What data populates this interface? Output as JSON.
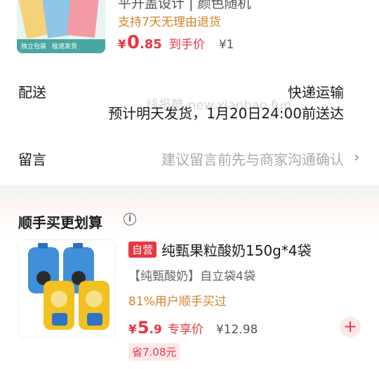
{
  "top_product": {
    "name_cut": "平开盖设计 | 颜色随机",
    "refund_policy": "支持7天无理由退货",
    "price_currency": "¥",
    "price_int": "0",
    "price_dec": ".85",
    "price_tag": "到手价",
    "original_price": "¥1",
    "thumb_badges": [
      "独立包装",
      "极速发货"
    ]
  },
  "delivery": {
    "label": "配送",
    "method": "快递运输",
    "estimate": "预计明天发货，1月20日24:00前送达"
  },
  "watermark": "线报酷 new.xianbao.fun",
  "message": {
    "label": "留言",
    "placeholder": "建议留言前先与商家沟通确认",
    "chevron": "›"
  },
  "bundle": {
    "title": "顺手买更划算",
    "info_glyph": "i",
    "item": {
      "badge": "自营",
      "name": "纯甄果粒酸奶150g*4袋",
      "subtitle": "【纯甄酸奶】自立袋4袋",
      "bought_pct": "81%用户顺手买过",
      "price_currency": "¥",
      "price_int": "5",
      "price_dec": ".9",
      "price_tag": "专享价",
      "original_price": "¥12.98",
      "save_label": "省7.08元",
      "add_glyph": "+"
    }
  },
  "colors": {
    "accent_red": "#e8373f",
    "accent_orange": "#d4822c",
    "muted": "#aaaaaa"
  }
}
